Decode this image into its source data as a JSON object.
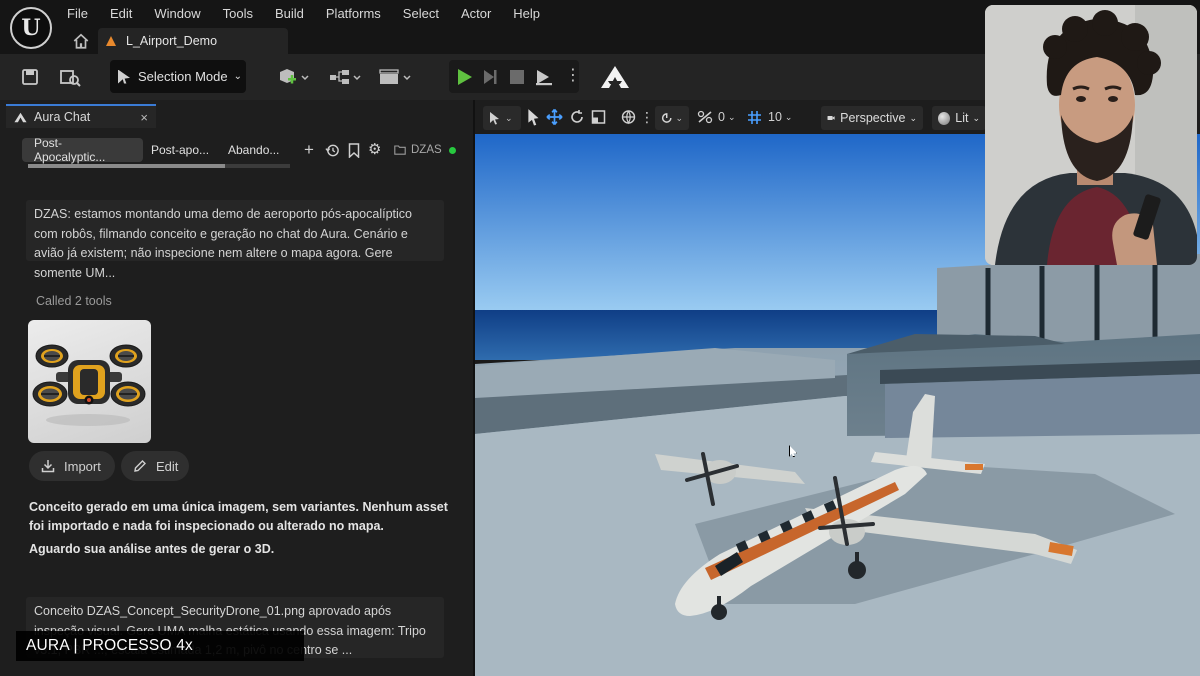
{
  "menu": {
    "items": [
      "File",
      "Edit",
      "Window",
      "Tools",
      "Build",
      "Platforms",
      "Select",
      "Actor",
      "Help"
    ]
  },
  "level_tab": {
    "label": "L_Airport_Demo"
  },
  "toolbar": {
    "selection_mode": "Selection Mode"
  },
  "panel": {
    "title": "Aura Chat",
    "close": "×",
    "chat_tabs": [
      "Post-Apocalyptic...",
      "Post-apo...",
      "Abando..."
    ],
    "project": "DZAS",
    "progress": 0.75
  },
  "chat": {
    "message1": "DZAS: estamos montando uma demo de aeroporto pós-apocalíptico com robôs, filmando conceito e geração no chat do Aura. Cenário e avião já existem; não inspecione nem altere o mapa agora. Gere somente UM...",
    "called_tools": "Called 2 tools",
    "import_label": "Import",
    "edit_label": "Edit",
    "response_line1": "Conceito gerado em uma única imagem, sem variantes. Nenhum asset",
    "response_line2": "foi importado e nada foi inspecionado ou alterado no mapa.",
    "response_line3": "Aguardo sua análise antes de gerar o 3D.",
    "message2": "Conceito DZAS_Concept_SecurityDrone_01.png aprovado após inspeção visual. Gere UMA malha estática usando essa imagem: Tripo v3.1, PBR ..., escala estimada 1,2 m, pivô no centro se ..."
  },
  "caption": {
    "text": "AURA  |  PROCESSO 4x"
  },
  "viewport": {
    "camera_speed": "0",
    "grid_snap": "10",
    "view_mode": "Perspective",
    "lighting": "Lit"
  },
  "colors": {
    "accent_blue": "#3a7bd5",
    "play_green": "#5fc140",
    "status_green": "#27c93f",
    "level_orange": "#e8892d"
  }
}
